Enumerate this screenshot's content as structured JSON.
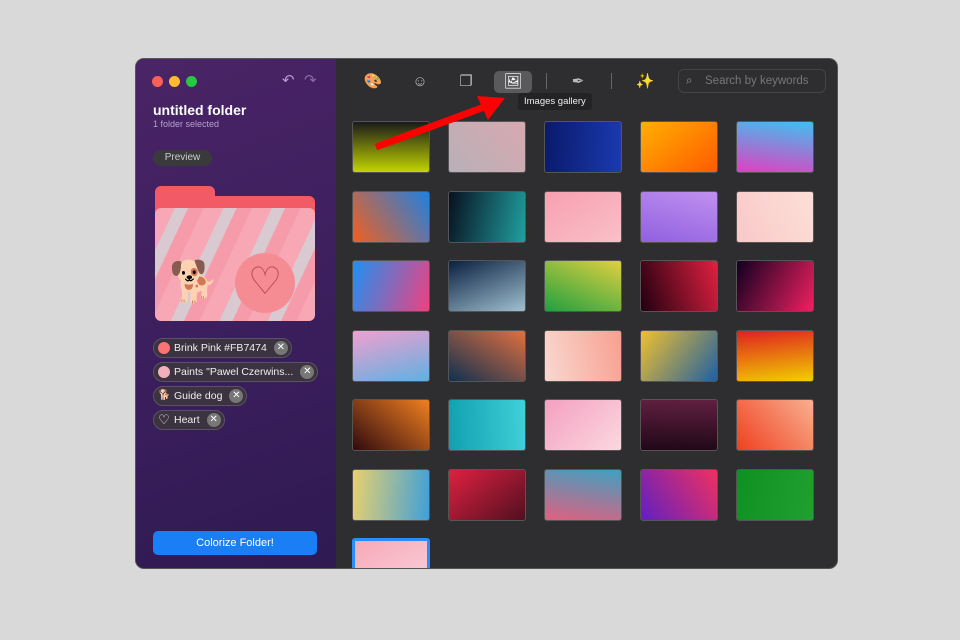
{
  "window": {
    "title": "untitled folder",
    "subtitle": "1 folder selected",
    "preview_label": "Preview",
    "colorize_label": "Colorize Folder!"
  },
  "tags": [
    {
      "label": "Brink Pink #FB7474",
      "icon": "color-swatch",
      "color": "#FB7474"
    },
    {
      "label": "Paints \"Pawel Czerwins...",
      "icon": "image-thumbnail",
      "color": "#f2b0bc"
    },
    {
      "label": "Guide dog",
      "icon": "dog-emoji",
      "glyph": "🐕"
    },
    {
      "label": "Heart",
      "icon": "heart-outline",
      "glyph": "♡"
    }
  ],
  "toolbar": {
    "items": [
      {
        "name": "palette",
        "glyph": "🎨"
      },
      {
        "name": "emoji",
        "glyph": "☺"
      },
      {
        "name": "shapes",
        "glyph": "❐"
      },
      {
        "name": "images-gallery",
        "glyph": "🖼"
      },
      {
        "name": "eyedropper",
        "glyph": "✒"
      },
      {
        "name": "magic-wand",
        "glyph": "✨"
      }
    ],
    "tooltip": "Images gallery",
    "search_placeholder": "Search by keywords"
  },
  "gallery": {
    "tiles": [
      [
        "#c2d400",
        "#1a1a1a"
      ],
      [
        "#b8b0b8",
        "#d8a8b0"
      ],
      [
        "#0a1a6a",
        "#1a3ab0"
      ],
      [
        "#ffb000",
        "#ff5a00"
      ],
      [
        "#e040c0",
        "#40c0f0"
      ],
      [
        "#f06020",
        "#2080e0"
      ],
      [
        "#081020",
        "#20a0a0"
      ],
      [
        "#f7a0b0",
        "#f9c0c8"
      ],
      [
        "#9060e0",
        "#c090f0"
      ],
      [
        "#f8c8c8",
        "#fde0d8"
      ],
      [
        "#2090f0",
        "#f04080"
      ],
      [
        "#0a2040",
        "#a0c0d0"
      ],
      [
        "#20a040",
        "#e0d040"
      ],
      [
        "#200010",
        "#e02040"
      ],
      [
        "#100020",
        "#f02060"
      ],
      [
        "#f0a0d0",
        "#60b0e0"
      ],
      [
        "#103050",
        "#e07040"
      ],
      [
        "#f8d8d0",
        "#f8a090"
      ],
      [
        "#f0c030",
        "#2060a0"
      ],
      [
        "#e02020",
        "#f0d000"
      ],
      [
        "#300a10",
        "#f08020"
      ],
      [
        "#10a0b0",
        "#40d0d8"
      ],
      [
        "#f4a0c0",
        "#fbd8e0"
      ],
      [
        "#200818",
        "#602040"
      ],
      [
        "#f04020",
        "#f8b090"
      ],
      [
        "#e8d070",
        "#40a0d8"
      ],
      [
        "#e02040",
        "#501020"
      ],
      [
        "#e06080",
        "#40a0c0"
      ],
      [
        "#6020c0",
        "#f03060"
      ],
      [
        "#109020",
        "#20a030"
      ],
      [
        "#f8a8b8",
        "#f8d0d8"
      ]
    ],
    "selected": 30
  }
}
